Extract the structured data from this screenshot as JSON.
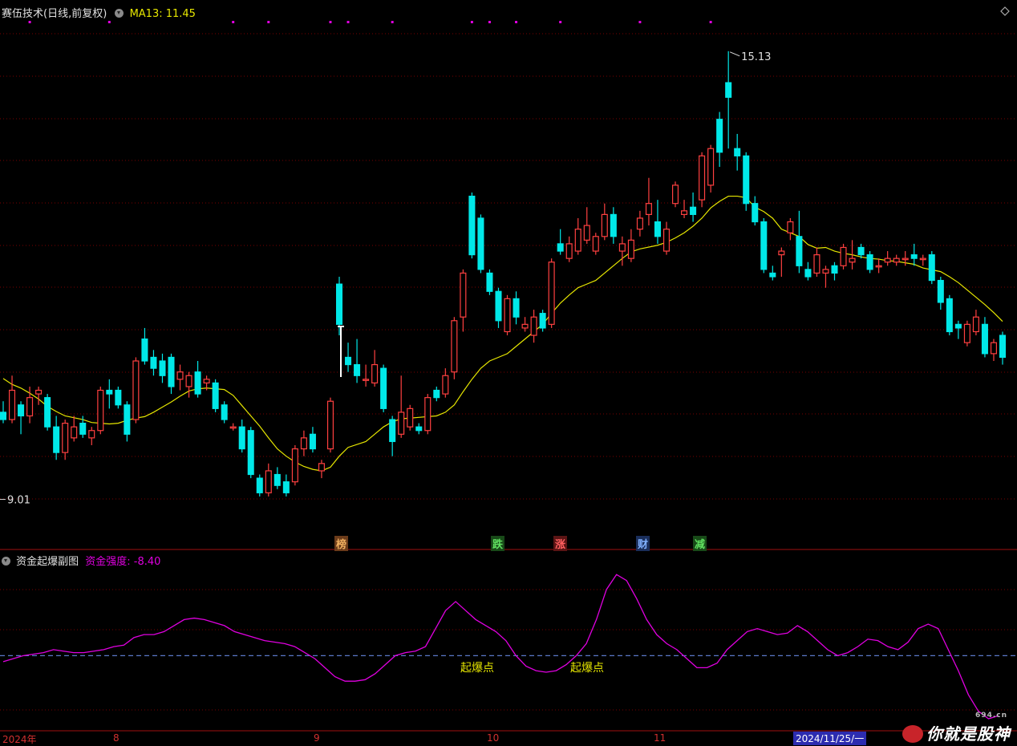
{
  "header": {
    "title": "赛伍技术(日线,前复权)",
    "ma_label": "MA13: 11.45"
  },
  "sub_header": {
    "title": "资金起爆副图",
    "indicator_label": "资金强度: -8.40"
  },
  "tags": {
    "bang": "榜",
    "die": "跌",
    "zhang": "涨",
    "cai": "财",
    "jian": "减"
  },
  "annotations": {
    "high": "15.13",
    "low": "9.01",
    "signal1": "起爆点",
    "signal2": "起爆点"
  },
  "x_axis": {
    "year": "2024年",
    "m8": "8",
    "m9": "9",
    "m10": "10",
    "m11": "11",
    "cursor_date": "2024/11/25/一"
  },
  "brand": {
    "text": "你就是股神",
    "small": "694.cn"
  },
  "colors": {
    "up": "#ff4040",
    "down": "#00e8e8",
    "ma": "#e6e600",
    "indicator": "#e000e0",
    "baseline": "#5a78c8",
    "grid": "#7a0000"
  },
  "chart_data": {
    "type": "candlestick",
    "price_range": [
      8.6,
      15.5
    ],
    "ma_period": 13,
    "high": 15.13,
    "low": 9.01,
    "candles_ohlc": [
      [
        10.2,
        10.35,
        10.05,
        10.1
      ],
      [
        10.1,
        10.7,
        10.05,
        10.5
      ],
      [
        10.3,
        10.35,
        9.9,
        10.15
      ],
      [
        10.15,
        10.55,
        10.05,
        10.4
      ],
      [
        10.45,
        10.55,
        10.3,
        10.5
      ],
      [
        10.4,
        10.45,
        9.95,
        10.0
      ],
      [
        10.0,
        10.15,
        9.55,
        9.65
      ],
      [
        9.65,
        10.1,
        9.55,
        10.05
      ],
      [
        9.85,
        10.15,
        9.8,
        10.0
      ],
      [
        10.05,
        10.15,
        9.85,
        9.9
      ],
      [
        9.85,
        10.0,
        9.75,
        9.95
      ],
      [
        9.95,
        10.55,
        9.9,
        10.5
      ],
      [
        10.5,
        10.65,
        10.25,
        10.45
      ],
      [
        10.5,
        10.55,
        10.25,
        10.3
      ],
      [
        10.3,
        10.35,
        9.8,
        9.9
      ],
      [
        10.1,
        10.95,
        10.05,
        10.9
      ],
      [
        11.2,
        11.35,
        10.85,
        10.9
      ],
      [
        10.95,
        11.05,
        10.7,
        10.8
      ],
      [
        10.9,
        11.0,
        10.6,
        10.7
      ],
      [
        10.95,
        11.0,
        10.45,
        10.55
      ],
      [
        10.65,
        10.85,
        10.5,
        10.75
      ],
      [
        10.55,
        10.75,
        10.4,
        10.7
      ],
      [
        10.75,
        10.9,
        10.4,
        10.45
      ],
      [
        10.6,
        10.7,
        10.5,
        10.65
      ],
      [
        10.6,
        10.65,
        10.2,
        10.25
      ],
      [
        10.3,
        10.35,
        10.05,
        10.1
      ],
      [
        10.0,
        10.05,
        9.95,
        10.0
      ],
      [
        10.0,
        10.1,
        9.65,
        9.7
      ],
      [
        9.95,
        10.0,
        9.3,
        9.35
      ],
      [
        9.3,
        9.35,
        9.05,
        9.1
      ],
      [
        9.1,
        9.5,
        9.05,
        9.4
      ],
      [
        9.35,
        9.45,
        9.15,
        9.2
      ],
      [
        9.25,
        9.35,
        9.05,
        9.1
      ],
      [
        9.25,
        9.75,
        9.2,
        9.7
      ],
      [
        9.7,
        9.95,
        9.6,
        9.85
      ],
      [
        9.9,
        10.0,
        9.65,
        9.7
      ],
      [
        9.4,
        9.55,
        9.3,
        9.5
      ],
      [
        9.7,
        10.4,
        9.65,
        10.35
      ],
      [
        11.95,
        12.05,
        11.25,
        11.4
      ],
      [
        10.95,
        11.15,
        10.75,
        10.85
      ],
      [
        10.85,
        11.2,
        10.6,
        10.7
      ],
      [
        10.65,
        10.85,
        10.55,
        10.65
      ],
      [
        10.6,
        11.05,
        10.55,
        10.85
      ],
      [
        10.8,
        10.85,
        10.2,
        10.25
      ],
      [
        10.1,
        10.15,
        9.6,
        9.8
      ],
      [
        9.9,
        10.7,
        9.85,
        10.2
      ],
      [
        10.0,
        10.3,
        9.95,
        10.25
      ],
      [
        10.0,
        10.05,
        9.9,
        9.95
      ],
      [
        9.95,
        10.45,
        9.9,
        10.4
      ],
      [
        10.5,
        10.55,
        10.35,
        10.4
      ],
      [
        10.45,
        10.8,
        10.4,
        10.7
      ],
      [
        10.75,
        11.5,
        10.65,
        11.45
      ],
      [
        11.5,
        12.15,
        11.3,
        12.1
      ],
      [
        13.15,
        13.2,
        12.3,
        12.35
      ],
      [
        12.85,
        12.9,
        12.1,
        12.15
      ],
      [
        12.1,
        12.15,
        11.8,
        11.85
      ],
      [
        11.85,
        11.9,
        11.35,
        11.45
      ],
      [
        11.3,
        11.8,
        11.25,
        11.75
      ],
      [
        11.75,
        11.85,
        11.4,
        11.5
      ],
      [
        11.35,
        11.5,
        11.3,
        11.4
      ],
      [
        11.25,
        11.6,
        11.15,
        11.5
      ],
      [
        11.55,
        11.6,
        11.3,
        11.35
      ],
      [
        11.4,
        12.3,
        11.35,
        12.25
      ],
      [
        12.5,
        12.7,
        12.35,
        12.4
      ],
      [
        12.3,
        12.6,
        12.25,
        12.5
      ],
      [
        12.4,
        12.85,
        12.35,
        12.7
      ],
      [
        12.55,
        13.0,
        12.5,
        12.75
      ],
      [
        12.4,
        12.65,
        12.35,
        12.6
      ],
      [
        12.6,
        13.05,
        12.55,
        12.9
      ],
      [
        12.9,
        13.0,
        12.5,
        12.6
      ],
      [
        12.4,
        12.6,
        12.2,
        12.5
      ],
      [
        12.3,
        12.7,
        12.25,
        12.55
      ],
      [
        12.7,
        12.95,
        12.6,
        12.85
      ],
      [
        12.9,
        13.4,
        12.75,
        13.05
      ],
      [
        12.8,
        13.1,
        12.5,
        12.6
      ],
      [
        12.4,
        12.8,
        12.35,
        12.7
      ],
      [
        13.05,
        13.35,
        13.0,
        13.3
      ],
      [
        12.9,
        13.1,
        12.85,
        12.95
      ],
      [
        13.0,
        13.2,
        12.8,
        12.9
      ],
      [
        13.1,
        13.75,
        13.0,
        13.7
      ],
      [
        13.3,
        13.85,
        13.2,
        13.8
      ],
      [
        14.2,
        14.3,
        13.55,
        13.75
      ],
      [
        14.7,
        15.13,
        13.8,
        14.5
      ],
      [
        13.8,
        14.0,
        13.5,
        13.7
      ],
      [
        13.7,
        13.75,
        12.95,
        13.05
      ],
      [
        13.05,
        13.15,
        12.75,
        12.8
      ],
      [
        12.8,
        12.85,
        12.1,
        12.15
      ],
      [
        12.1,
        12.2,
        12.0,
        12.05
      ],
      [
        12.35,
        12.45,
        12.05,
        12.4
      ],
      [
        12.65,
        12.85,
        12.55,
        12.8
      ],
      [
        12.6,
        12.95,
        12.1,
        12.2
      ],
      [
        12.15,
        12.25,
        12.0,
        12.05
      ],
      [
        12.1,
        12.45,
        12.05,
        12.35
      ],
      [
        12.1,
        12.2,
        11.9,
        12.15
      ],
      [
        12.2,
        12.25,
        12.0,
        12.1
      ],
      [
        12.2,
        12.5,
        12.15,
        12.45
      ],
      [
        12.25,
        12.55,
        12.15,
        12.3
      ],
      [
        12.45,
        12.5,
        12.3,
        12.35
      ],
      [
        12.35,
        12.4,
        12.1,
        12.15
      ],
      [
        12.2,
        12.3,
        12.1,
        12.2
      ],
      [
        12.25,
        12.4,
        12.2,
        12.3
      ],
      [
        12.25,
        12.35,
        12.2,
        12.3
      ],
      [
        12.3,
        12.4,
        12.2,
        12.3
      ],
      [
        12.35,
        12.5,
        12.2,
        12.3
      ],
      [
        12.3,
        12.35,
        12.2,
        12.3
      ],
      [
        12.35,
        12.4,
        11.95,
        12.0
      ],
      [
        12.0,
        12.05,
        11.6,
        11.7
      ],
      [
        11.75,
        11.8,
        11.25,
        11.3
      ],
      [
        11.4,
        11.45,
        11.2,
        11.35
      ],
      [
        11.15,
        11.45,
        11.1,
        11.4
      ],
      [
        11.3,
        11.6,
        11.25,
        11.5
      ],
      [
        11.4,
        11.5,
        10.95,
        11.0
      ],
      [
        11.0,
        11.2,
        10.9,
        11.15
      ],
      [
        11.25,
        11.3,
        10.85,
        10.95
      ]
    ],
    "ma13": [
      10.66,
      10.58,
      10.53,
      10.46,
      10.38,
      10.28,
      10.21,
      10.15,
      10.1,
      10.06,
      10.05,
      10.04,
      10.05,
      10.09,
      10.12,
      10.14,
      10.2,
      10.27,
      10.34,
      10.42,
      10.49,
      10.52,
      10.53,
      10.51,
      10.43,
      10.29,
      10.15,
      10.01,
      9.85,
      9.7,
      9.6,
      9.52,
      9.46,
      9.42,
      9.4,
      9.45,
      9.6,
      9.72,
      9.8,
      9.9,
      10.0,
      10.07,
      10.11,
      10.12,
      10.13,
      10.14,
      10.15,
      10.2,
      10.3,
      10.48,
      10.65,
      10.8,
      10.9,
      11.0,
      11.1,
      11.2,
      11.3,
      11.4,
      11.55,
      11.69,
      11.8,
      11.9,
      11.95,
      12.0,
      12.1,
      12.2,
      12.3,
      12.39,
      12.43,
      12.48,
      12.52,
      12.58,
      12.65,
      12.74,
      12.85,
      12.99,
      13.08,
      13.15,
      13.15,
      13.13,
      13.0,
      12.94,
      12.85,
      12.7,
      12.6,
      12.49,
      12.44,
      12.45,
      12.4,
      12.37,
      12.35,
      12.32,
      12.3,
      12.29,
      12.27,
      12.26,
      12.24,
      12.22,
      12.17,
      12.12,
      12.05,
      11.97,
      11.87,
      11.77,
      11.67,
      11.56,
      11.44
    ],
    "indicator": {
      "name": "资金强度",
      "last": -8.4,
      "baseline": 0,
      "range": [
        -25,
        30
      ],
      "values": [
        -2,
        -1,
        0,
        0.5,
        1,
        2,
        1.5,
        1,
        1,
        1.5,
        2,
        3,
        3.5,
        6,
        7,
        7,
        8,
        10,
        12,
        12.5,
        12,
        11,
        10,
        8,
        7,
        6,
        5,
        4.5,
        4,
        3,
        1,
        -1,
        -4,
        -7,
        -8.5,
        -8.5,
        -8,
        -6,
        -3,
        0,
        1,
        1.5,
        3,
        9,
        15,
        18,
        15,
        12,
        10,
        8,
        5,
        0,
        -3.5,
        -5,
        -5.5,
        -5,
        -3,
        0,
        4,
        12,
        22,
        27,
        25,
        19,
        12,
        7,
        4,
        2,
        -1,
        -4,
        -4,
        -2.5,
        2,
        5,
        8,
        9,
        8,
        7,
        7.5,
        10,
        8,
        5,
        2,
        0,
        1,
        3,
        5.5,
        5,
        3,
        2,
        4.5,
        9,
        10.5,
        9,
        2,
        -5,
        -13,
        -18.5,
        -21,
        -20
      ]
    }
  }
}
